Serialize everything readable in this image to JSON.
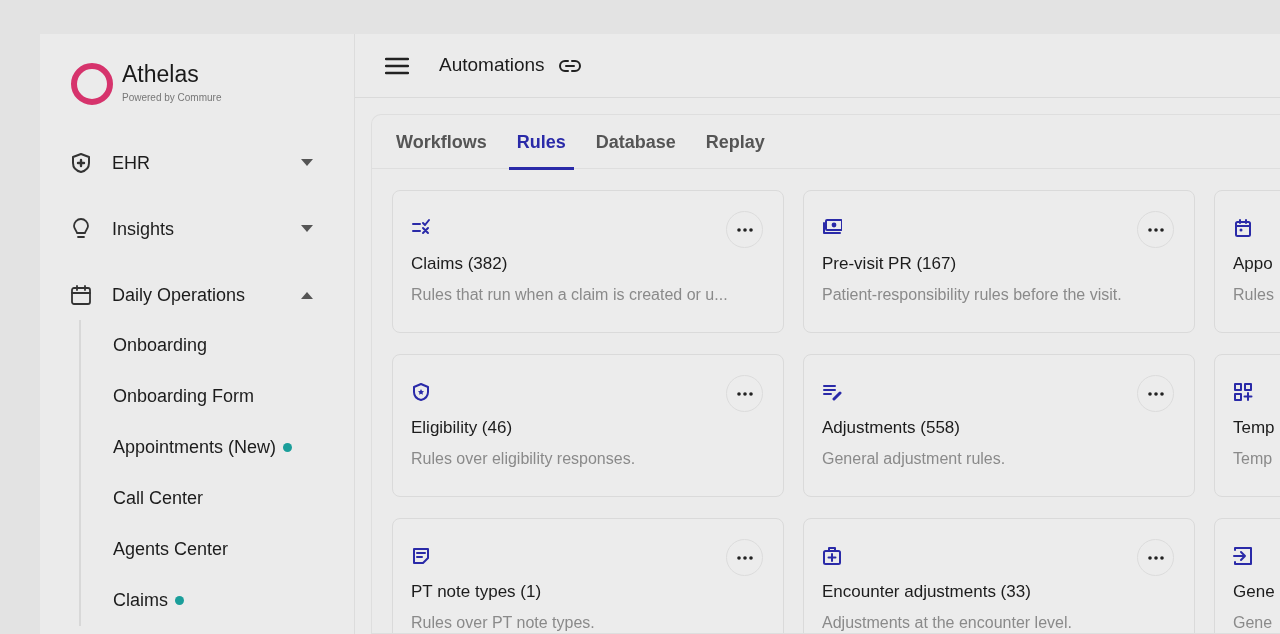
{
  "brand": {
    "name": "Athelas",
    "tagline": "Powered by Commure"
  },
  "sidebar": {
    "items": [
      {
        "label": "EHR",
        "expanded": false
      },
      {
        "label": "Insights",
        "expanded": false
      },
      {
        "label": "Daily Operations",
        "expanded": true,
        "children": [
          {
            "label": "Onboarding",
            "dot": false
          },
          {
            "label": "Onboarding Form",
            "dot": false
          },
          {
            "label": "Appointments (New)",
            "dot": true
          },
          {
            "label": "Call Center",
            "dot": false
          },
          {
            "label": "Agents Center",
            "dot": false
          },
          {
            "label": "Claims",
            "dot": true
          }
        ]
      }
    ]
  },
  "header": {
    "title": "Automations"
  },
  "tabs": [
    {
      "label": "Workflows",
      "selected": false
    },
    {
      "label": "Rules",
      "selected": true
    },
    {
      "label": "Database",
      "selected": false
    },
    {
      "label": "Replay",
      "selected": false
    }
  ],
  "cards": [
    {
      "title": "Claims (382)",
      "description": "Rules that run when a claim is created or u..."
    },
    {
      "title": "Pre-visit PR (167)",
      "description": "Patient-responsibility rules before the visit."
    },
    {
      "title": "Appo",
      "description": "Rules"
    },
    {
      "title": "Eligibility (46)",
      "description": "Rules over eligibility responses."
    },
    {
      "title": "Adjustments (558)",
      "description": "General adjustment rules."
    },
    {
      "title": "Temp",
      "description": "Temp"
    },
    {
      "title": "PT note types (1)",
      "description": "Rules over PT note types."
    },
    {
      "title": "Encounter adjustments (33)",
      "description": "Adjustments at the encounter level."
    },
    {
      "title": "Gene",
      "description": "Gene"
    }
  ]
}
